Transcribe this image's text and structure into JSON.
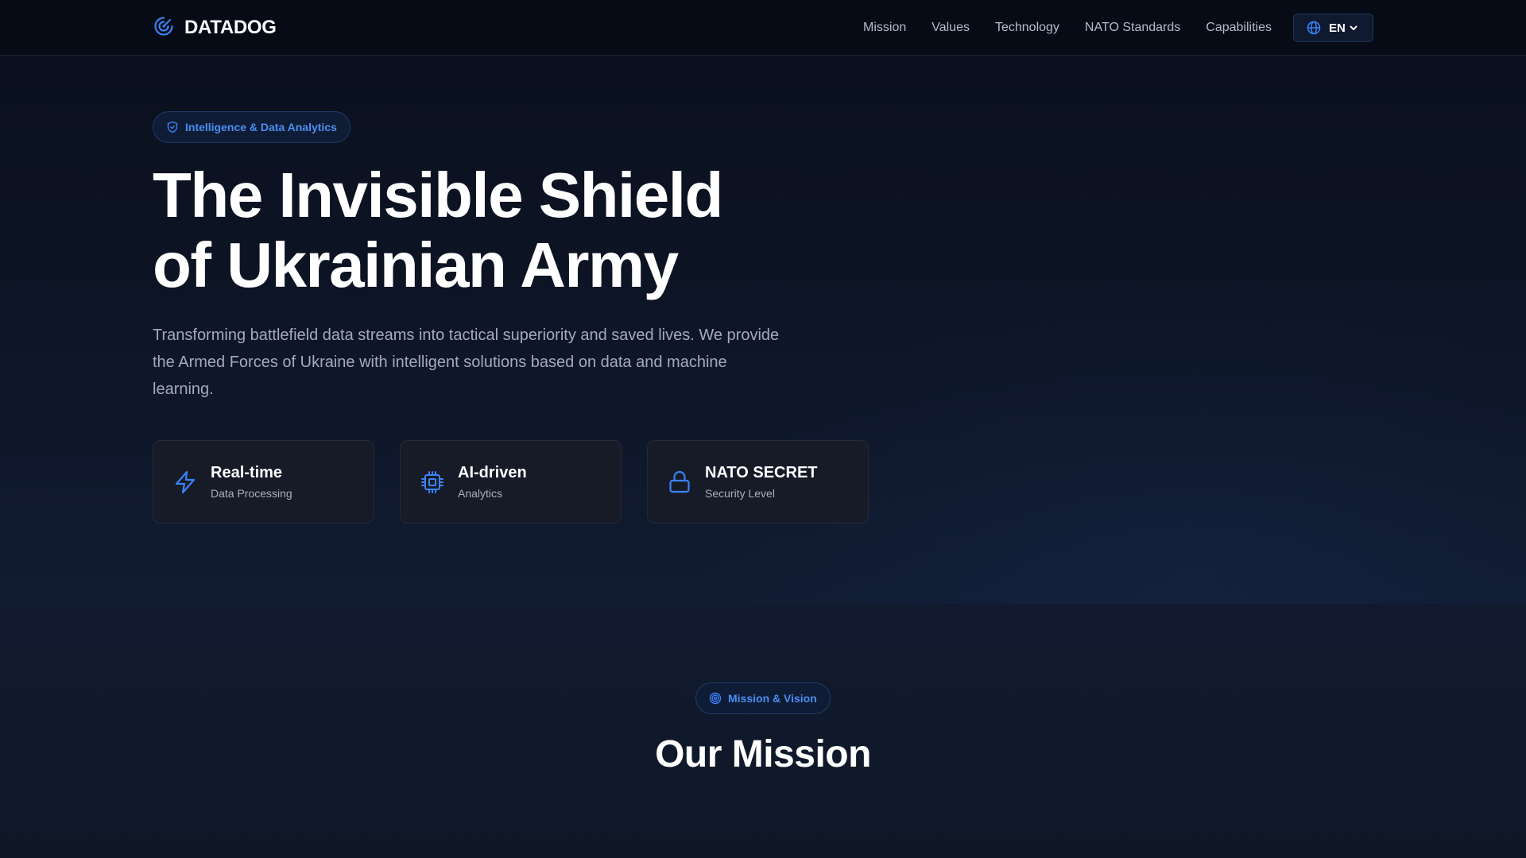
{
  "header": {
    "brand": "DATADOG",
    "nav": [
      "Mission",
      "Values",
      "Technology",
      "NATO Standards",
      "Capabilities"
    ],
    "language": "EN"
  },
  "hero": {
    "badge": "Intelligence & Data Analytics",
    "title_line1": "The Invisible Shield",
    "title_line2": "of Ukrainian Army",
    "description": "Transforming battlefield data streams into tactical superiority and saved lives. We provide the Armed Forces of Ukraine with intelligent solutions based on data and machine learning.",
    "features": [
      {
        "icon": "lightning-icon",
        "title": "Real-time",
        "subtitle": "Data Processing"
      },
      {
        "icon": "cpu-chip-icon",
        "title": "AI-driven",
        "subtitle": "Analytics"
      },
      {
        "icon": "lock-icon",
        "title": "NATO SECRET",
        "subtitle": "Security Level"
      }
    ]
  },
  "mission": {
    "badge": "Mission & Vision",
    "title": "Our Mission"
  },
  "colors": {
    "accent": "#3b82f6",
    "badge_text": "#4a8ef0",
    "background": "#0f1524"
  }
}
